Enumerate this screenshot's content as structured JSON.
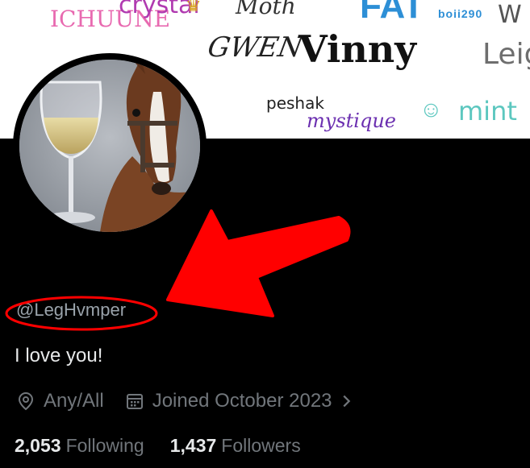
{
  "banner": {
    "signatures": {
      "ichuune": "ICHUUNE",
      "crystal": "crystal",
      "moth": "Moth",
      "fat": "FAT",
      "boii": "boii290",
      "w": "W",
      "gwen": "GWEN",
      "vinny": "Vinny",
      "leig": "Leig",
      "peshak": "peshak",
      "mystique": "mystique",
      "mint": "mint"
    }
  },
  "profile": {
    "emoji": "🐱",
    "handle": "@LegHvmper",
    "bio": "I love you!",
    "location": "Any/All",
    "joined": "Joined October 2023",
    "following_count": "2,053",
    "following_label": "Following",
    "followers_count": "1,437",
    "followers_label": "Followers"
  },
  "icons": {
    "location": "location-pin-icon",
    "calendar": "calendar-icon",
    "chevron": "chevron-right-icon"
  },
  "colors": {
    "background": "#000000",
    "primary_text": "#e7e9ea",
    "secondary_text": "#71767b",
    "annotation_red": "#ff0000"
  }
}
